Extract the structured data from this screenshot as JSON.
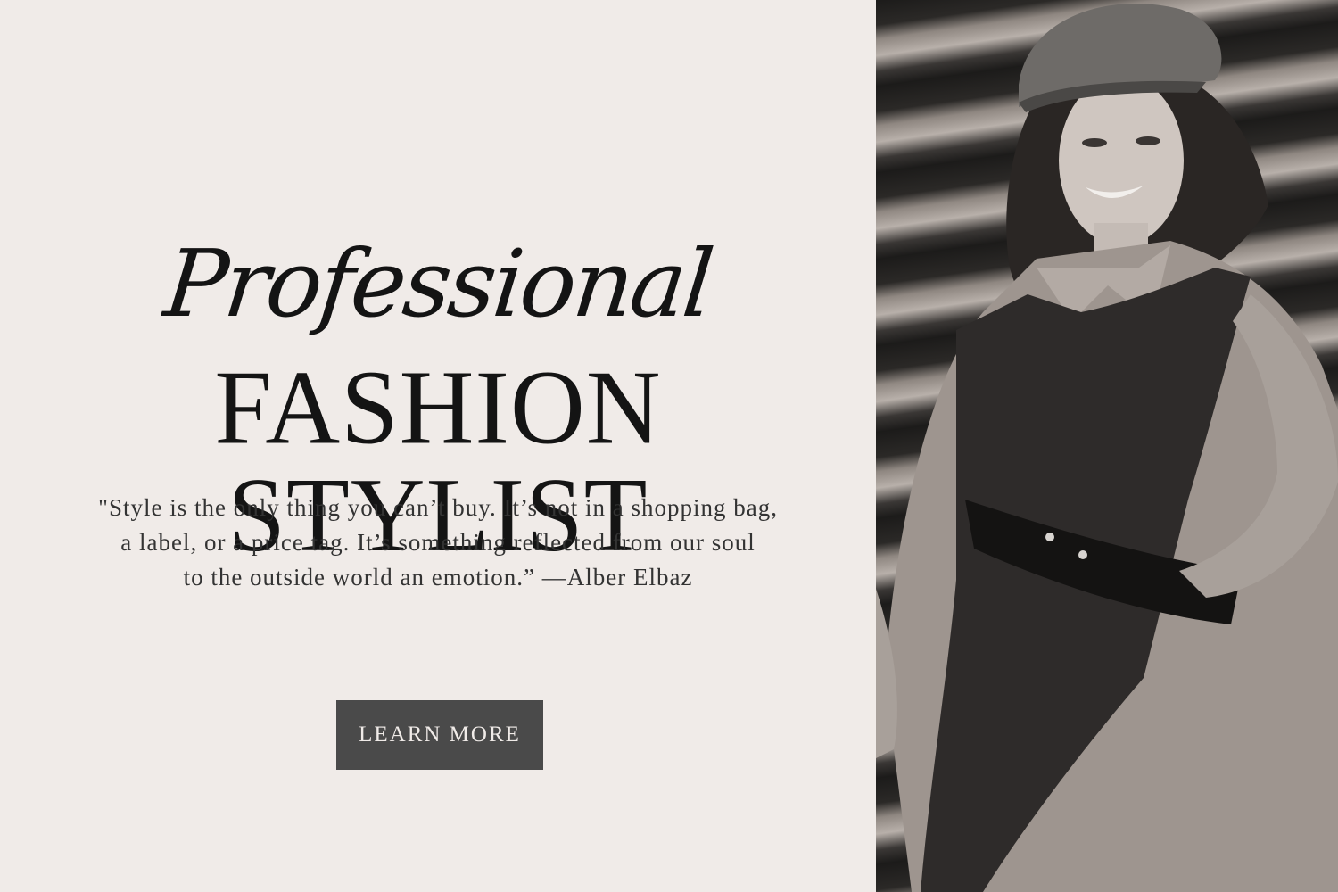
{
  "hero": {
    "script_title": "Professional",
    "main_title": "FASHION STYLIST",
    "quote_lines": [
      "\"Style is the only thing you can’t buy. It’s not in a shopping bag,",
      "a label, or a price tag. It’s something reflected from our soul",
      "to the outside world an emotion.” —Alber Elbaz"
    ],
    "cta_label": "LEARN MORE"
  },
  "colors": {
    "background": "#f0ebe8",
    "text": "#141414",
    "button": "#4a4a4a",
    "button_text": "#f0ebe8"
  },
  "photo": {
    "subject": "smiling woman in newsboy cap wearing shirt with dark belted vest, black and white",
    "icon": "portrait-photo"
  }
}
